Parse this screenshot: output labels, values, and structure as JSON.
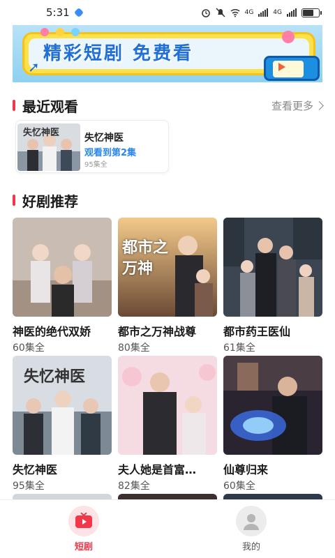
{
  "status_bar": {
    "time": "5:31",
    "net1": "4G",
    "net2": "4G"
  },
  "banner": {
    "text": "精彩短剧 免费看"
  },
  "recent": {
    "title": "最近观看",
    "see_more": "查看更多",
    "item": {
      "title": "失忆神医",
      "progress": "观看到第2集",
      "count": "95集全",
      "poster_text": "失忆神医"
    }
  },
  "recommend": {
    "title": "好剧推荐",
    "items": [
      {
        "title": "神医的绝代双娇",
        "count": "60集全"
      },
      {
        "title": "都市之万神战尊",
        "count": "80集全",
        "poster_text": "都市之万神"
      },
      {
        "title": "都市药王医仙",
        "count": "61集全"
      },
      {
        "title": "失忆神医",
        "count": "95集全",
        "poster_text": "失忆神医"
      },
      {
        "title": "夫人她是首富…",
        "count": "82集全"
      },
      {
        "title": "仙尊归来",
        "count": "60集全"
      }
    ]
  },
  "tabs": [
    {
      "label": "短剧",
      "icon": "tv-icon",
      "active": true
    },
    {
      "label": "我的",
      "icon": "person-icon",
      "active": false
    }
  ],
  "colors": {
    "accent": "#f2374a",
    "link": "#2a86f2"
  }
}
